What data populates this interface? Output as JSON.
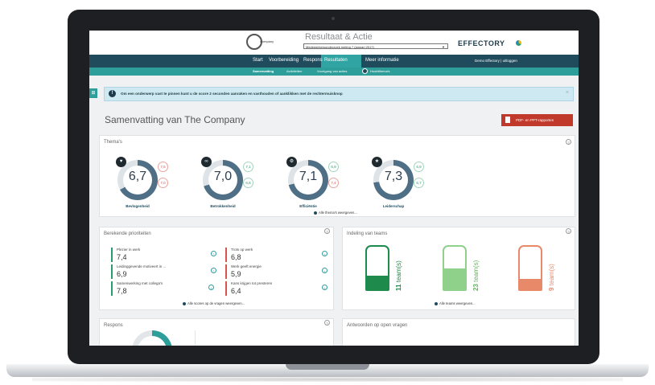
{
  "header": {
    "logo_text": "Company",
    "app_title": "Resultaat & Actie",
    "survey_select": "Medewerkersonderzoek meting 7 (januari 2017)",
    "brand": "EFFECTORY"
  },
  "nav": {
    "items": [
      "Start",
      "Voorbereiding",
      "Respons",
      "Resultaten",
      "Meer informatie"
    ],
    "active": "Resultaten",
    "user": "Demo Effectory | uitloggen"
  },
  "subnav": {
    "items": [
      "Samenvatting",
      "Activiteiten",
      "Voortgang van acties",
      "Hoofdthema's"
    ]
  },
  "alert": {
    "text": "Om een onderwerp vast te pinnen kunt u de score 2 seconden aanraken en vasthouden of aanklikken met de rechtermuisknop"
  },
  "page": {
    "title": "Samenvatting van The Company",
    "pdf_button": "PDF- en PPT-rapporten"
  },
  "themes": {
    "title": "Thema's",
    "items": [
      {
        "name": "Bevlogenheid",
        "score": "6,7",
        "comp1": "7,5",
        "comp2": "7,0",
        "fill": 0.67
      },
      {
        "name": "Betrokkenheid",
        "score": "7,0",
        "comp1": "7,1",
        "comp2": "6,8",
        "fill": 0.7
      },
      {
        "name": "Efficiëntie",
        "score": "7,1",
        "comp1": "6,9",
        "comp2": "7,4",
        "fill": 0.71
      },
      {
        "name": "Leiderschap",
        "score": "7,3",
        "comp1": "6,9",
        "comp2": "6,7",
        "fill": 0.73
      }
    ],
    "show_all": "Alle thema's weergeven..."
  },
  "priorities": {
    "title": "Berekende prioriteiten",
    "left": [
      {
        "label": "Plezier in werk",
        "value": "7,4"
      },
      {
        "label": "Leidinggevende motiveert in ...",
        "value": "6,9"
      },
      {
        "label": "Samenwerking met collega's",
        "value": "7,8"
      }
    ],
    "right": [
      {
        "label": "Trots op werk",
        "value": "6,8"
      },
      {
        "label": "Werk geeft energie",
        "value": "5,9"
      },
      {
        "label": "Kans krijgen tot presteren",
        "value": "6,4"
      }
    ],
    "show_all": "Alle scores op de vragen weergeven..."
  },
  "teams": {
    "title": "Indeling van teams",
    "items": [
      {
        "count": "11",
        "unit": "team(s)",
        "color": "#1e8a4c",
        "fill": 0.33
      },
      {
        "count": "23",
        "unit": "team(s)",
        "color": "#8fd08a",
        "fill": 0.5
      },
      {
        "count": "9",
        "unit": "team(s)",
        "color": "#e8896a",
        "fill": 0.25
      }
    ],
    "show_all": "Alle teams weergeven..."
  },
  "respons": {
    "title": "Respons"
  },
  "open_answers": {
    "title": "Antwoorden op open vragen"
  },
  "colors": {
    "accent": "#2e9e9b",
    "nav": "#1f4b5c",
    "red": "#d9534f",
    "green": "#2a9d6e"
  }
}
